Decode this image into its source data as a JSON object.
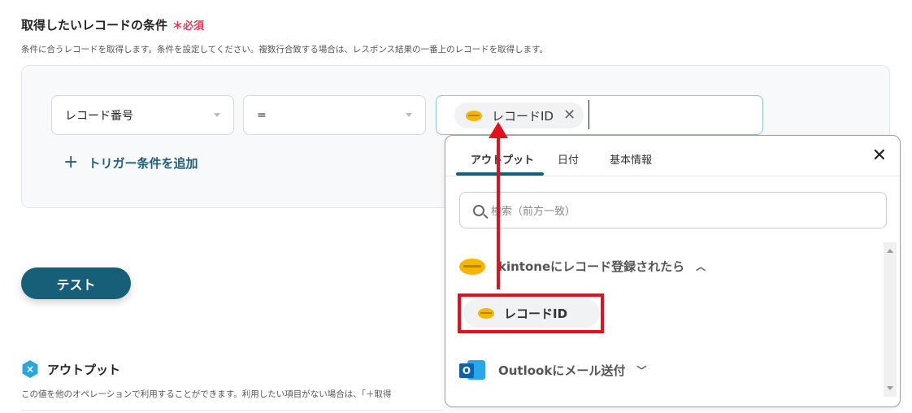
{
  "section": {
    "title": "取得したいレコードの条件",
    "required_mark": "＊必須",
    "description": "条件に合うレコードを取得します。条件を設定してください。複数行合致する場合は、レスポンス結果の一番上のレコードを取得します。"
  },
  "condition": {
    "field_select": "レコード番号",
    "operator_select": "=",
    "value_chip": "レコードID",
    "add_trigger": "トリガー条件を追加"
  },
  "test_button": "テスト",
  "output": {
    "heading": "アウトプット",
    "description": "この値を他のオペレーションで利用することができます。利用したい項目がない場合は、「＋取得"
  },
  "dropdown": {
    "tabs": [
      "アウトプット",
      "日付",
      "基本情報"
    ],
    "search_placeholder": "検索（前方一致）",
    "groups": [
      {
        "label": "kintoneにレコード登録されたら",
        "icon": "kintone-icon",
        "expanded": true
      },
      {
        "label": "Outlookにメール送付",
        "icon": "outlook-icon",
        "expanded": false
      }
    ],
    "items": [
      {
        "label": "レコードID"
      }
    ]
  },
  "colors": {
    "accent": "#175f78",
    "annotation_red": "#e3101d",
    "required": "#e23b4f"
  }
}
